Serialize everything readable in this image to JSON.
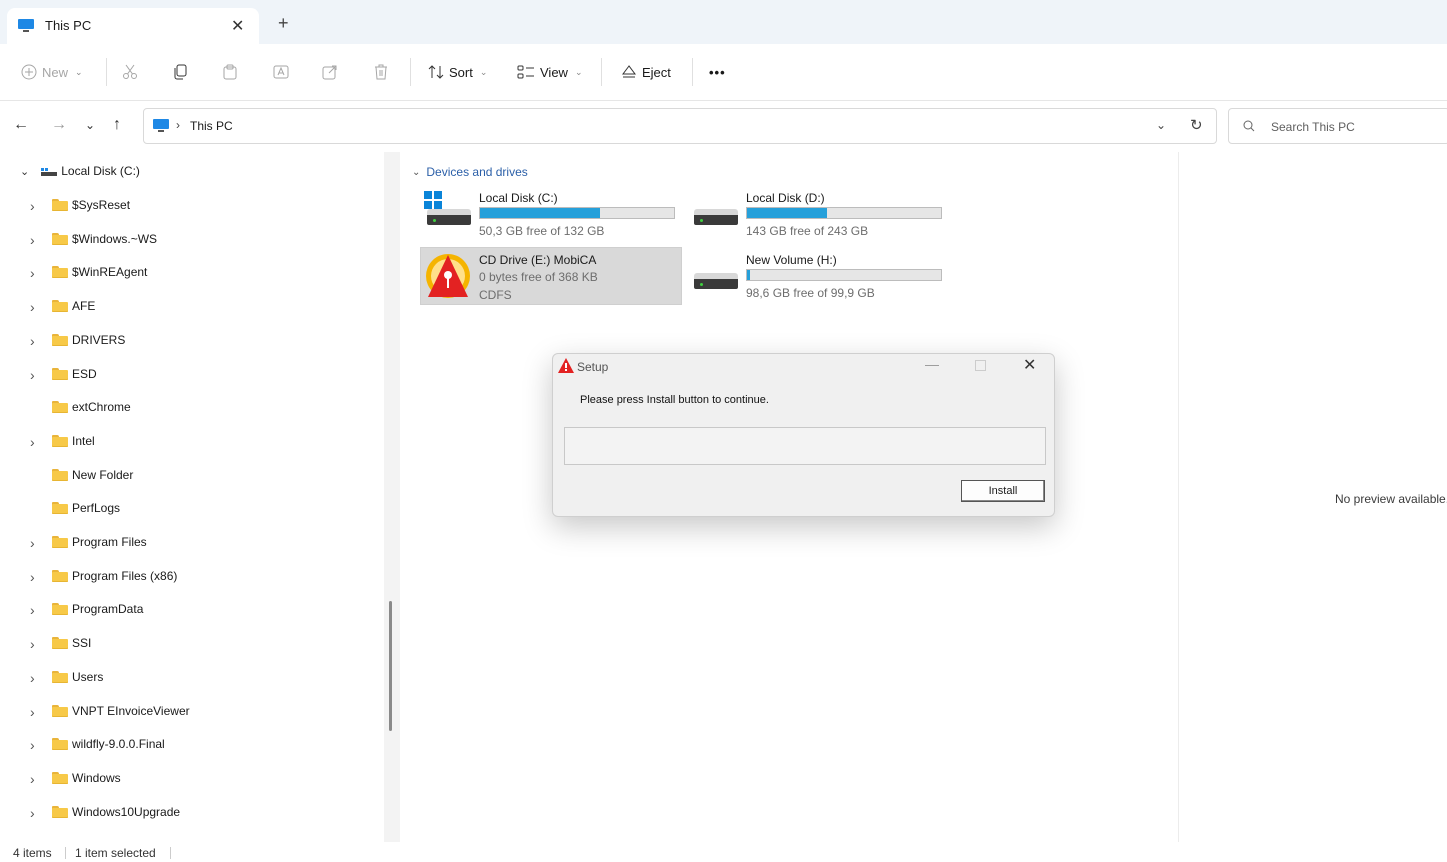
{
  "window": {
    "tab_title": "This PC",
    "tab_close_icon": "close-icon",
    "new_tab_label": "+"
  },
  "toolbar": {
    "new_label": "New",
    "sort_label": "Sort",
    "view_label": "View",
    "eject_label": "Eject",
    "more_label": "•••"
  },
  "address": {
    "location": "This PC",
    "search_placeholder": "Search This PC"
  },
  "sidebar": {
    "root_label": "Local Disk (C:)",
    "items": [
      {
        "label": "$SysReset",
        "expandable": true
      },
      {
        "label": "$Windows.~WS",
        "expandable": true
      },
      {
        "label": "$WinREAgent",
        "expandable": true
      },
      {
        "label": "AFE",
        "expandable": true
      },
      {
        "label": "DRIVERS",
        "expandable": true
      },
      {
        "label": "ESD",
        "expandable": true
      },
      {
        "label": "extChrome",
        "expandable": false
      },
      {
        "label": "Intel",
        "expandable": true
      },
      {
        "label": "New Folder",
        "expandable": false
      },
      {
        "label": "PerfLogs",
        "expandable": false
      },
      {
        "label": "Program Files",
        "expandable": true
      },
      {
        "label": "Program Files (x86)",
        "expandable": true
      },
      {
        "label": "ProgramData",
        "expandable": true
      },
      {
        "label": "SSI",
        "expandable": true
      },
      {
        "label": "Users",
        "expandable": true
      },
      {
        "label": "VNPT EInvoiceViewer",
        "expandable": true
      },
      {
        "label": "wildfly-9.0.0.Final",
        "expandable": true
      },
      {
        "label": "Windows",
        "expandable": true
      },
      {
        "label": "Windows10Upgrade",
        "expandable": true
      }
    ]
  },
  "main": {
    "group_label": "Devices and drives",
    "drives": [
      {
        "name": "Local Disk (C:)",
        "free_text": "50,3 GB free of 132 GB",
        "used_fraction": 0.62
      },
      {
        "name": "Local Disk (D:)",
        "free_text": "143 GB free of 243 GB",
        "used_fraction": 0.41
      },
      {
        "name": "CD Drive (E:) MobiCA",
        "free_text": "0 bytes free of 368 KB",
        "fs_text": "CDFS"
      },
      {
        "name": "New Volume (H:)",
        "free_text": "98,6 GB free of 99,9 GB",
        "used_fraction": 0.013
      }
    ],
    "no_preview": "No preview available."
  },
  "status": {
    "items_count": "4 items",
    "selected": "1 item selected"
  },
  "dialog": {
    "title": "Setup",
    "message": "Please press Install button to continue.",
    "install_label": "Install"
  },
  "colors": {
    "accent": "#26a0da",
    "folder": "#f7c948",
    "dialog_bg": "#f0f0f0"
  }
}
